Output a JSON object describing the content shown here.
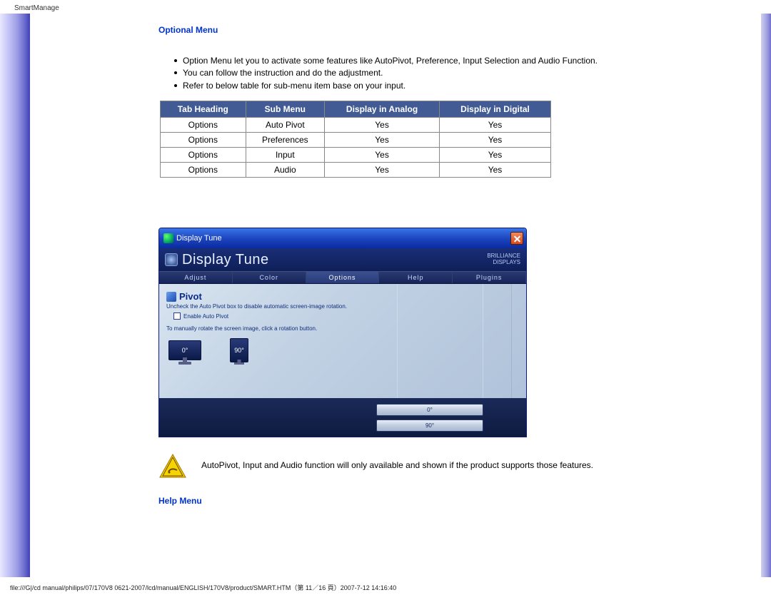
{
  "header": {
    "text": "SmartManage"
  },
  "sections": {
    "optional_title": "Optional Menu",
    "help_title": "Help Menu"
  },
  "bullets": [
    "Option Menu let you to activate some features like AutoPivot, Preference, Input Selection and Audio Function.",
    "You can follow the instruction and do the adjustment.",
    "Refer to below table for sub-menu item base on your input."
  ],
  "table": {
    "headers": [
      "Tab Heading",
      "Sub Menu",
      "Display in Analog",
      "Display in Digital"
    ],
    "rows": [
      [
        "Options",
        "Auto Pivot",
        "Yes",
        "Yes"
      ],
      [
        "Options",
        "Preferences",
        "Yes",
        "Yes"
      ],
      [
        "Options",
        "Input",
        "Yes",
        "Yes"
      ],
      [
        "Options",
        "Audio",
        "Yes",
        "Yes"
      ]
    ]
  },
  "display_tune": {
    "window_title": "Display Tune",
    "brand": "Display Tune",
    "brand_right1": "BRILLIANCE",
    "brand_right2": "DISPLAYS",
    "tabs": [
      "Adjust",
      "Color",
      "Options",
      "Help",
      "Plugins"
    ],
    "active_tab": 2,
    "section_label": "Pivot",
    "desc1": "Uncheck the Auto Pivot box to disable automatic screen-image rotation.",
    "checkbox_label": "Enable Auto Pivot",
    "desc2": "To manually rotate the screen image, click a rotation button.",
    "thumb0": "0°",
    "thumb90": "90°",
    "footer_btn1": "0°",
    "footer_btn2": "90°"
  },
  "warning_note": "AutoPivot, Input and Audio function will only available and shown if the product supports those features.",
  "footer": "file:///G|/cd manual/philips/07/170V8 0621-2007/lcd/manual/ENGLISH/170V8/product/SMART.HTM（第 11／16 頁）2007-7-12 14:16:40"
}
